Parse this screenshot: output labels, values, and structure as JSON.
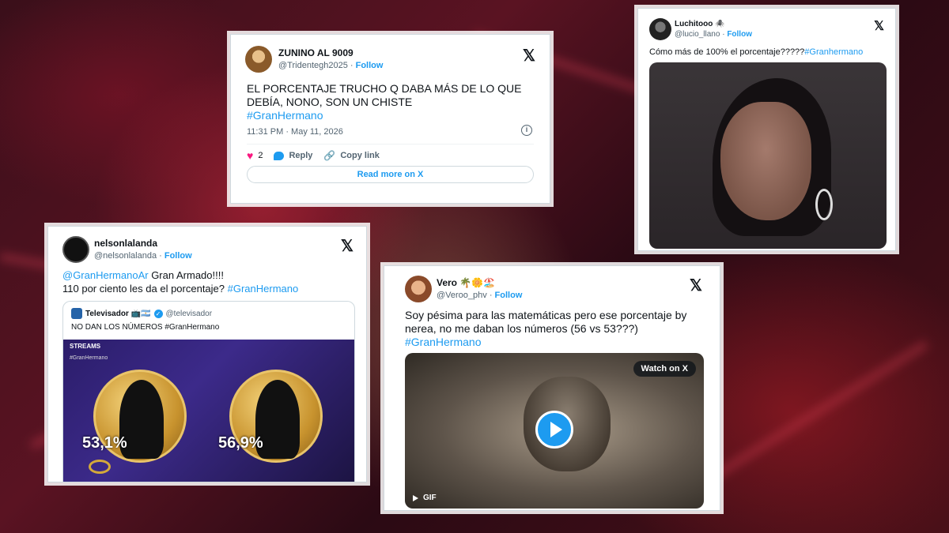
{
  "platform_follow_label": "Follow",
  "tweets": {
    "zunino": {
      "name": "ZUNINO AL 9009",
      "handle": "@Tridentegh2025",
      "follow": "Follow",
      "text": "EL PORCENTAJE TRUCHO Q DABA MÁS DE LO QUE DEBÍA, NONO, SON UN CHISTE",
      "hashtag": "#GranHermano",
      "timestamp": "11:31 PM · May 11, 2026",
      "likes": "2",
      "reply_label": "Reply",
      "copy_label": "Copy link",
      "read_more": "Read more on X",
      "avatar_color": "#c98a4a"
    },
    "luchitooo": {
      "name": "Luchitooo 🕷️",
      "handle": "@lucio_llano",
      "follow": "Follow",
      "text": "Cómo más de 100% el porcentaje?????",
      "hashtag": "#Granhermano"
    },
    "nelson": {
      "name": "nelsonlalanda",
      "handle": "@nelsonlalanda",
      "follow": "Follow",
      "mention": "@GranHermanoAr",
      "text_after_mention": " Gran Armado!!!!",
      "text_line2": "110 por ciento les da el porcentaje?",
      "hashtag": "#GranHermano",
      "quoted": {
        "name": "Televisador 📺🇦🇷",
        "handle": "@televisador",
        "text": "NO DAN LOS NÚMEROS #GranHermano",
        "media_tag": "STREAMS",
        "media_hashtag": "#GranHermano",
        "pct_left": "53,1%",
        "pct_right": "56,9%"
      }
    },
    "vero": {
      "name": "Vero 🌴🌼🏖️",
      "handle": "@Veroo_phv",
      "follow": "Follow",
      "text": "Soy pésima para las matemáticas pero ese porcentaje by nerea, no me daban los números (56 vs 53???)",
      "hashtag": "#GranHermano",
      "watch_label": "Watch on X",
      "gif_label": "GIF"
    }
  }
}
